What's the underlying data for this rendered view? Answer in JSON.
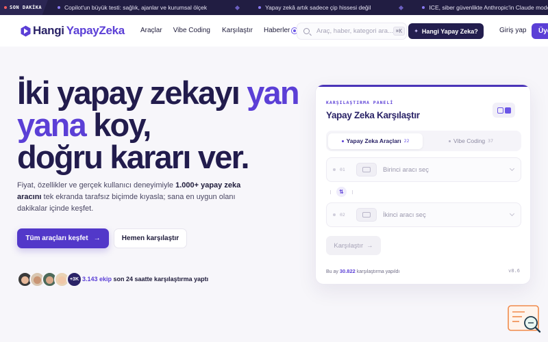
{
  "ticker": {
    "badge": "SON DAKİKA",
    "items": [
      "Copilot'un büyük testi: sağlık, ajanlar ve kurumsal ölçek",
      "Yapay zekâ artık sadece çip hissesi değil",
      "ICE, siber güvenlikte Anthropic'in Claude modeline geçti"
    ]
  },
  "nav": {
    "logo_part1": "Hangi",
    "logo_part2": "YapayZeka",
    "links": [
      "Araçlar",
      "Vibe Coding",
      "Karşılaştır",
      "Haberler"
    ],
    "search_placeholder": "Araç, haber, kategori ara...",
    "search_shortcut": "⌘K",
    "cta_label": "Hangi Yapay Zeka?",
    "login_label": "Giriş yap",
    "signup_label": "Üye ol"
  },
  "hero": {
    "title_line1_a": "İki yapay zekayı ",
    "title_line1_b": "yan",
    "title_line2_a": "yana",
    "title_line2_b": " koy,",
    "title_line3": "doğru kararı ver.",
    "desc_a": "Fiyat, özellikler ve gerçek kullanıcı deneyimiyle ",
    "desc_bold": "1.000+ yapay zeka aracını",
    "desc_b": " tek ekranda tarafsız biçimde kıyasla; sana en uygun olanı dakikalar içinde keşfet.",
    "cta_primary": "Tüm araçları keşfet",
    "cta_secondary": "Hemen karşılaştır",
    "avatar_more": "+3K",
    "social_count": "3.143 ekip",
    "social_text": " son 24 saatte karşılaştırma yaptı"
  },
  "panel": {
    "kicker": "KARŞILAŞTIRMA PANELİ",
    "title": "Yapay Zeka Karşılaştır",
    "tab_active": {
      "label": "Yapay Zeka Araçları",
      "count": "22"
    },
    "tab_inactive": {
      "label": "Vibe Coding",
      "count": "37"
    },
    "slot1": {
      "num": "01",
      "placeholder": "Birinci aracı seç"
    },
    "slot2": {
      "num": "02",
      "placeholder": "İkinci aracı seç"
    },
    "swap_symbol": "⇅",
    "compare_label": "Karşılaştır",
    "footer_prefix": "Bu ay ",
    "footer_count": "30.822",
    "footer_suffix": " karşılaştırma yapıldı",
    "version": "v8.6"
  },
  "colors": {
    "brand": "#5b3fd6",
    "dark": "#221c4d",
    "ticker_bg": "#211d42"
  },
  "avatars_colors": [
    "#3a3a3a",
    "#d9c6b0",
    "#4d6a5a",
    "#e9d3b5"
  ]
}
